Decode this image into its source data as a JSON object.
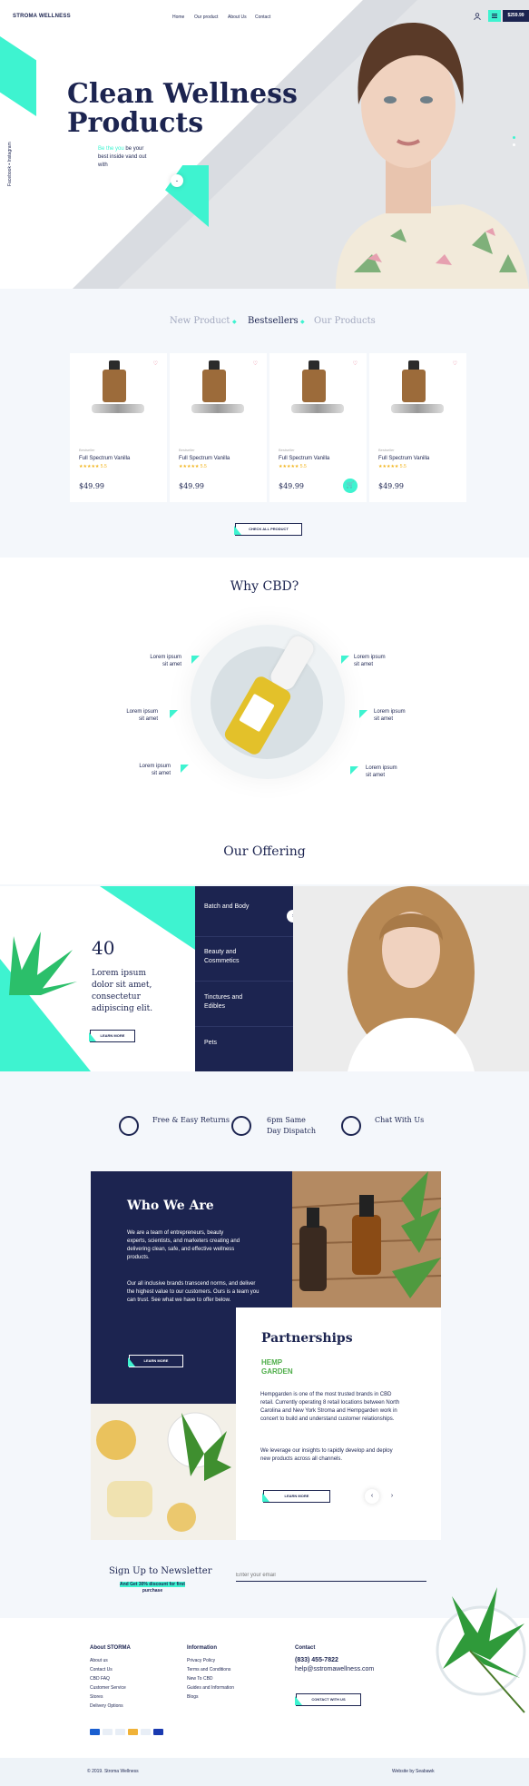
{
  "header": {
    "brand": "STROMA WELLNESS",
    "nav": [
      "Home",
      "Our product",
      "About Us",
      "Contact"
    ],
    "cart_price": "$259.99"
  },
  "hero": {
    "title_line1": "Clean Wellness",
    "title_line2": "Products",
    "subtitle_highlight": "Be the you",
    "subtitle_rest": "be your best inside vand out with",
    "social": "Facebook  •  Instagram"
  },
  "products": {
    "tabs": [
      "New Product",
      "Bestsellers",
      "Our Products"
    ],
    "items": [
      {
        "category": "Bestseller",
        "name": "Full Spectrum Vanilla",
        "rating": "★★★★★ 5.5",
        "price": "$49.99"
      },
      {
        "category": "Bestseller",
        "name": "Full Spectrum Vanilla",
        "rating": "★★★★★ 5.5",
        "price": "$49.99"
      },
      {
        "category": "Bestseller",
        "name": "Full Spectrum Vanilla",
        "rating": "★★★★★ 5.5",
        "price": "$49.99"
      },
      {
        "category": "Bestseller",
        "name": "Full Spectrum Vanilla",
        "rating": "★★★★★ 5.5",
        "price": "$49.99"
      }
    ],
    "check_all": "CHECK ALL PRODUCT"
  },
  "why": {
    "title": "Why CBD?",
    "point1": "Lorem ipsum sit amet",
    "point2": "Lorem ipsum sit amet",
    "point3": "Lorem ipsum sit amet",
    "point4": "Lorem ipsum sit amet",
    "point5": "Lorem ipsum sit amet",
    "point6": "Lorem ipsum sit amet"
  },
  "offering": {
    "title": "Our Offering",
    "number": "40",
    "text": "Lorem ipsum dolor sit amet, consectetur adipiscing elit.",
    "learn_more": "LEARN MORE",
    "items": [
      "Batch and Body",
      "Beauty and Cosmmetics",
      "Tinctures and Edibles",
      "Pets"
    ]
  },
  "features": [
    {
      "label": "Free & Easy Returns",
      "icon": "box-icon"
    },
    {
      "label": "6pm Same Day Dispatch",
      "icon": "clock-icon"
    },
    {
      "label": "Chat With Us",
      "icon": "chat-icon"
    }
  ],
  "who": {
    "title": "Who We Are",
    "para1": "We are a team of entrepreneurs, beauty experts, scientists, and marketers creating and delivering clean, safe, and effective wellness products.",
    "para2": "Our all inclusive brands transcend norms, and deliver the highest value to our customers. Ours is a team you can trust. See what we have to offer below.",
    "learn_more": "LEARN MORE"
  },
  "partnerships": {
    "title": "Partnerships",
    "logo": "HEMP GARDEN",
    "para1": "Hempgarden is one of the most trusted brands in CBD retail. Currently operating 8 retail locations between North Carolina and New York Stroma and Hempgarden work in concert to build and understand customer relationships.",
    "para2": "We leverage our insights to rapidly develop and deploy new products across all channels.",
    "learn_more": "LEARN MORE"
  },
  "newsletter": {
    "title": "Sign Up to Newsletter",
    "promo": "And Get 30% discount for first purchase",
    "placeholder": "Enter your email"
  },
  "footer": {
    "about_title": "About STORMA",
    "about_links": [
      "About us",
      "Contact Us",
      "CBD FAQ",
      "Customer Service",
      "Stores",
      "Delivery Options"
    ],
    "info_title": "Information",
    "info_links": [
      "Privacy Policy",
      "Terms and Conditions",
      "New To CBD",
      "Guides and Information",
      "Blogs"
    ],
    "contact_title": "Contact",
    "phone": "(833) 455-7822",
    "email": "help@sstromawellness.com",
    "contact_btn": "CONTACT WITH US",
    "copyright": "© 2019. Stroma Wellness",
    "credit": "Website by Seabawk"
  },
  "colors": {
    "navy": "#1c2450",
    "mint": "#3ef3d0"
  }
}
